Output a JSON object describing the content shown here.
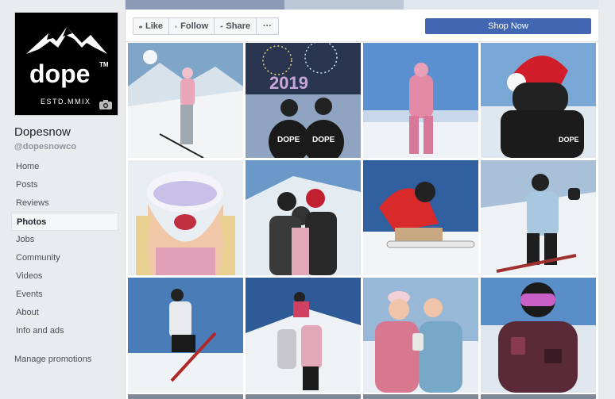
{
  "sidebar": {
    "logo_text": "dope",
    "logo_tm": "TM",
    "logo_est": "ESTD.MMIX",
    "page_name": "Dopesnow",
    "handle": "@dopesnowco",
    "nav": [
      {
        "label": "Home"
      },
      {
        "label": "Posts"
      },
      {
        "label": "Reviews"
      },
      {
        "label": "Photos"
      },
      {
        "label": "Jobs"
      },
      {
        "label": "Community"
      },
      {
        "label": "Videos"
      },
      {
        "label": "Events"
      },
      {
        "label": "About"
      },
      {
        "label": "Info and ads"
      }
    ],
    "active_item": "Photos",
    "manage_promotions": "Manage promotions"
  },
  "actionbar": {
    "like": "Like",
    "follow": "Follow",
    "share": "Share",
    "more": "···",
    "shop_now": "Shop Now"
  },
  "photos": [
    {
      "name": "photo-skier-pink-jacket"
    },
    {
      "name": "photo-fireworks-2019",
      "overlay_text": "2019",
      "jacket_text": "DOPE"
    },
    {
      "name": "photo-pink-onesie"
    },
    {
      "name": "photo-santa-hat-helmet",
      "jacket_text": "DOPE"
    },
    {
      "name": "photo-goggles-closeup"
    },
    {
      "name": "photo-group-selfie"
    },
    {
      "name": "photo-red-jacket-snowboard"
    },
    {
      "name": "photo-snowboarder-blue-jacket"
    },
    {
      "name": "photo-skier-jump"
    },
    {
      "name": "photo-friends-on-slope"
    },
    {
      "name": "photo-two-skiers-selfie"
    },
    {
      "name": "photo-helmet-camo-jacket"
    }
  ],
  "colors": {
    "brand_blue": "#4267b2",
    "background": "#e9ebee"
  }
}
